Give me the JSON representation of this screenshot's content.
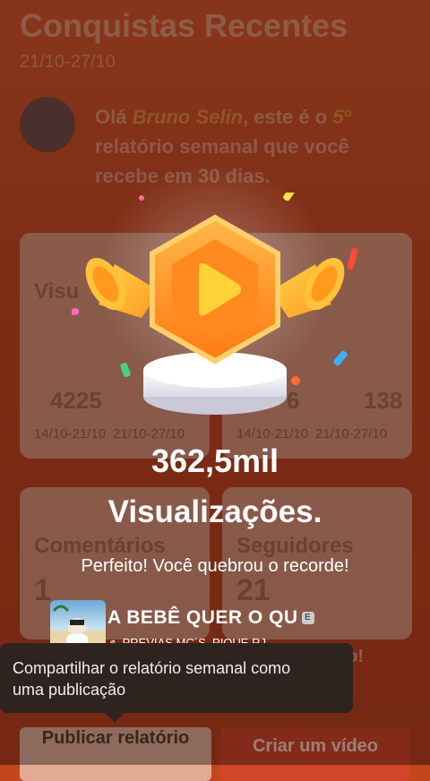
{
  "header": {
    "title": "Conquistas Recentes",
    "date_range": "21/10-27/10"
  },
  "greeting": {
    "prefix": "Olá ",
    "user": "Bruno Selin",
    "middle": ", este é o ",
    "ordinal": "5º",
    "suffix": " relatório semanal que você recebe em 30 dias."
  },
  "cards": {
    "views": {
      "label": "Visu",
      "current": "4225",
      "current_range": "14/10-21/10",
      "previous_range": "21/10-27/10"
    },
    "likes": {
      "value": "6",
      "emoji_value": "138",
      "current_range": "14/10-21/10",
      "previous_range": "21/10-27/10"
    },
    "comments": {
      "label": "Comentários",
      "value": "1"
    },
    "followers": {
      "label": "Seguidores",
      "value": "21",
      "extra": "abaixo!"
    }
  },
  "popup": {
    "value": "362,5mil",
    "label": "Visualizações.",
    "message": "Perfeito! Você quebrou o recorde!"
  },
  "music": {
    "title": "A BEBÊ QUER O QU",
    "artist": "♬ PREVIAS MC´S, PIQUE RJ",
    "badge": "E"
  },
  "tooltip": {
    "text": "Compartilhar o relatório semanal como uma publicação"
  },
  "buttons": {
    "publish": "Publicar relatório",
    "create": "Criar um vídeo"
  },
  "colors": {
    "accent": "#d5452d",
    "medal": "#ff8a1f",
    "play": "#ffd23a"
  }
}
